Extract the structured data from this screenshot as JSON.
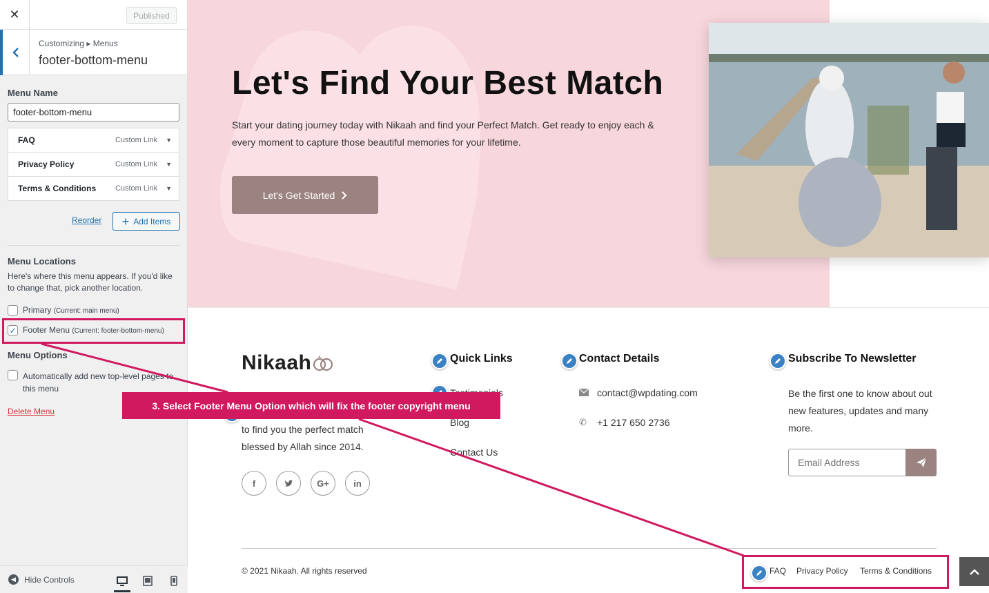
{
  "customizer": {
    "published_label": "Published",
    "breadcrumb": "Customizing ▸ Menus",
    "section_title": "footer-bottom-menu",
    "menu_name_label": "Menu Name",
    "menu_name_value": "footer-bottom-menu",
    "menu_items": [
      {
        "title": "FAQ",
        "type": "Custom Link"
      },
      {
        "title": "Privacy Policy",
        "type": "Custom Link"
      },
      {
        "title": "Terms & Conditions",
        "type": "Custom Link"
      }
    ],
    "reorder_label": "Reorder",
    "add_items_label": "Add Items",
    "locations_label": "Menu Locations",
    "locations_desc": "Here's where this menu appears. If you'd like to change that, pick another location.",
    "location_primary": {
      "label": "Primary",
      "current": "(Current: main menu)",
      "checked": false
    },
    "location_footer": {
      "label": "Footer Menu",
      "current": "(Current: footer-bottom-menu)",
      "checked": true
    },
    "options_label": "Menu Options",
    "auto_add_label": "Automatically add new top-level pages to this menu",
    "delete_label": "Delete Menu",
    "hide_controls_label": "Hide Controls"
  },
  "hero": {
    "title": "Let's Find Your Best Match",
    "text": "Start your dating journey today with Nikaah and find your Perfect Match. Get ready to enjoy each & every moment to capture those beautiful memories for your lifetime.",
    "cta_label": "Let's Get Started"
  },
  "footer": {
    "logo": "Nikaah",
    "about_text": "to find you the perfect match blessed by Allah since 2014.",
    "quick_links_title": "Quick Links",
    "quick_links": [
      "Testimonials",
      "Blog",
      "Contact Us"
    ],
    "contact_title": "Contact Details",
    "email": "contact@wpdating.com",
    "phone": "+1 217 650 2736",
    "newsletter_title": "Subscribe To Newsletter",
    "newsletter_text": "Be the first one to know about out new features, updates and many more.",
    "email_placeholder": "Email Address",
    "copyright": "© 2021 Nikaah. All rights reserved",
    "bottom_menu": [
      "FAQ",
      "Privacy Policy",
      "Terms & Conditions"
    ],
    "social_icons": [
      "facebook-icon",
      "twitter-icon",
      "google-plus-icon",
      "linkedin-icon"
    ]
  },
  "annotation": {
    "tooltip": "3. Select Footer Menu Option which will fix the footer copyright menu",
    "color": "#d0195e"
  },
  "colors": {
    "wp_blue": "#2271b1",
    "hero_bg": "#f7d6dc",
    "button_mauve": "#9b8382",
    "edit_pencil": "#3b82c4"
  }
}
